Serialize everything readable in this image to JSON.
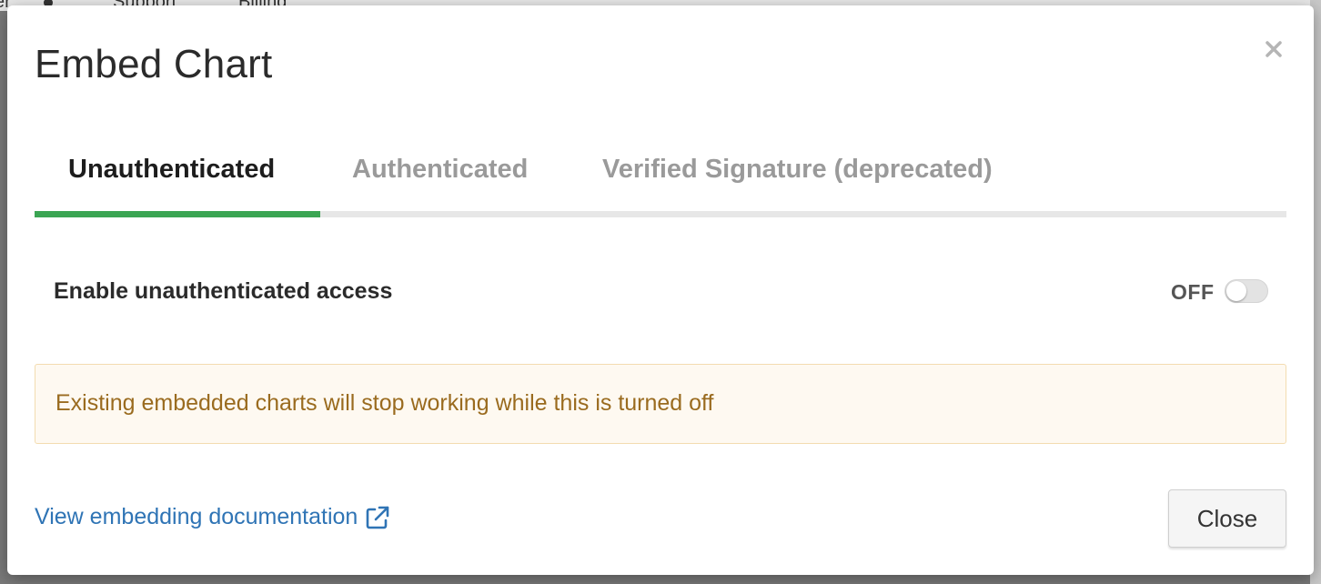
{
  "background": {
    "nav_items": [
      "er",
      "Support",
      "Billing"
    ]
  },
  "modal": {
    "title": "Embed Chart",
    "close_icon": "close-icon",
    "tabs": [
      {
        "label": "Unauthenticated",
        "active": true
      },
      {
        "label": "Authenticated",
        "active": false
      },
      {
        "label": "Verified Signature (deprecated)",
        "active": false
      }
    ],
    "accent_color": "#3ba553",
    "access_toggle": {
      "label": "Enable unauthenticated access",
      "state_text": "OFF",
      "enabled": false
    },
    "warning": {
      "text": "Existing embedded charts will stop working while this is turned off",
      "color": "#9a6b1f"
    },
    "footer": {
      "doc_link_label": "View embedding documentation",
      "doc_link_icon": "external-link-icon",
      "close_button_label": "Close"
    }
  }
}
